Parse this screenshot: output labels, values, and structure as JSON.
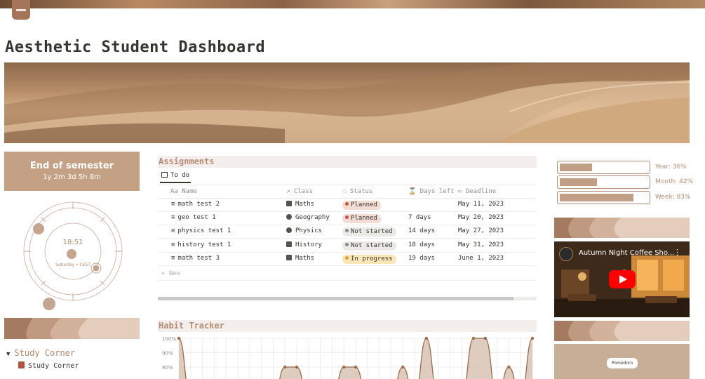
{
  "page": {
    "title": "Aesthetic Student Dashboard"
  },
  "semester": {
    "title": "End of semester",
    "countdown": "1y 2m 3d 5h 8m"
  },
  "clock": {
    "time": "18:51",
    "date": "Saturday • CEST"
  },
  "study_corner": {
    "toggle_label": "Study Corner",
    "link_label": "Study Corner"
  },
  "assignments": {
    "title": "Assignments",
    "view_tab": "To do",
    "columns": {
      "name": "Name",
      "class": "Class",
      "status": "Status",
      "days_left": "Days left",
      "deadline": "Deadline"
    },
    "rows": [
      {
        "name": "math test 2",
        "class": "Maths",
        "status": "Planned",
        "days_left": "",
        "deadline": "May 11, 2023"
      },
      {
        "name": "geo test 1",
        "class": "Geography",
        "status": "Planned",
        "days_left": "7 days",
        "deadline": "May 20, 2023"
      },
      {
        "name": "physics test 1",
        "class": "Physics",
        "status": "Not started",
        "days_left": "14 days",
        "deadline": "May 27, 2023"
      },
      {
        "name": "history test 1",
        "class": "History",
        "status": "Not started",
        "days_left": "18 days",
        "deadline": "May 31, 2023"
      },
      {
        "name": "math test 3",
        "class": "Maths",
        "status": "In progress",
        "days_left": "19 days",
        "deadline": "June 1, 2023"
      }
    ],
    "new_label": "+ New"
  },
  "habit_tracker": {
    "title": "Habit Tracker"
  },
  "progress": {
    "year": {
      "label": "Year: 36%",
      "value": 36
    },
    "month": {
      "label": "Month: 42%",
      "value": 42
    },
    "week": {
      "label": "Week: 83%",
      "value": 83
    }
  },
  "video": {
    "title": "Autumn Night Coffee Sho..."
  },
  "pomodoro": {
    "button_label": "Pomodoro"
  },
  "colors": {
    "accent": "#b48d74",
    "section_bg": "#f4eeec",
    "chart_fill": "#d8c3b4",
    "chart_line": "#9c6a4c"
  },
  "chart_data": {
    "type": "area",
    "title": "",
    "ylabel": "",
    "ylim": [
      70,
      100
    ],
    "y_ticks": [
      "100%",
      "90%",
      "80%"
    ],
    "values": [
      100,
      0,
      0,
      0,
      0,
      0,
      0,
      0,
      0,
      80,
      80,
      0,
      0,
      0,
      80,
      80,
      0,
      0,
      0,
      80,
      0,
      100,
      0,
      0,
      0,
      100,
      100,
      0,
      80,
      0,
      100
    ]
  }
}
